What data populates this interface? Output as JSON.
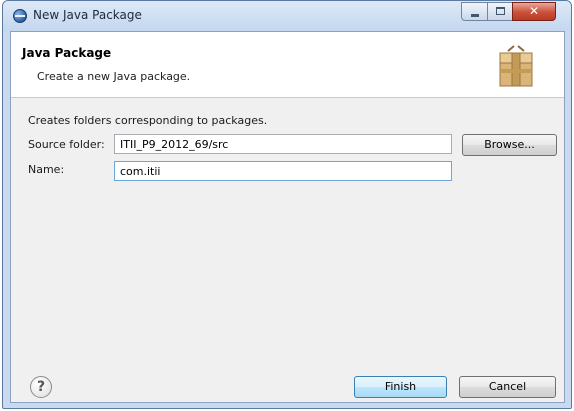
{
  "window": {
    "title": "New Java Package",
    "close_glyph": "✕"
  },
  "header": {
    "title": "Java Package",
    "description": "Create a new Java package."
  },
  "form": {
    "description": "Creates folders corresponding to packages.",
    "source_folder_label": "Source folder:",
    "source_folder_value": "ITII_P9_2012_69/src",
    "browse_label": "Browse...",
    "name_label": "Name:",
    "name_value": "com.itii"
  },
  "footer": {
    "help_glyph": "?",
    "finish_label": "Finish",
    "cancel_label": "Cancel"
  },
  "icons": {
    "app": "eclipse-icon",
    "header": "package-icon",
    "help": "help-icon"
  },
  "colors": {
    "titlebar": "#c4d7ef",
    "close_button": "#c9503a",
    "default_button": "#a7d9f5",
    "dialog_background": "#f0f0f0"
  }
}
